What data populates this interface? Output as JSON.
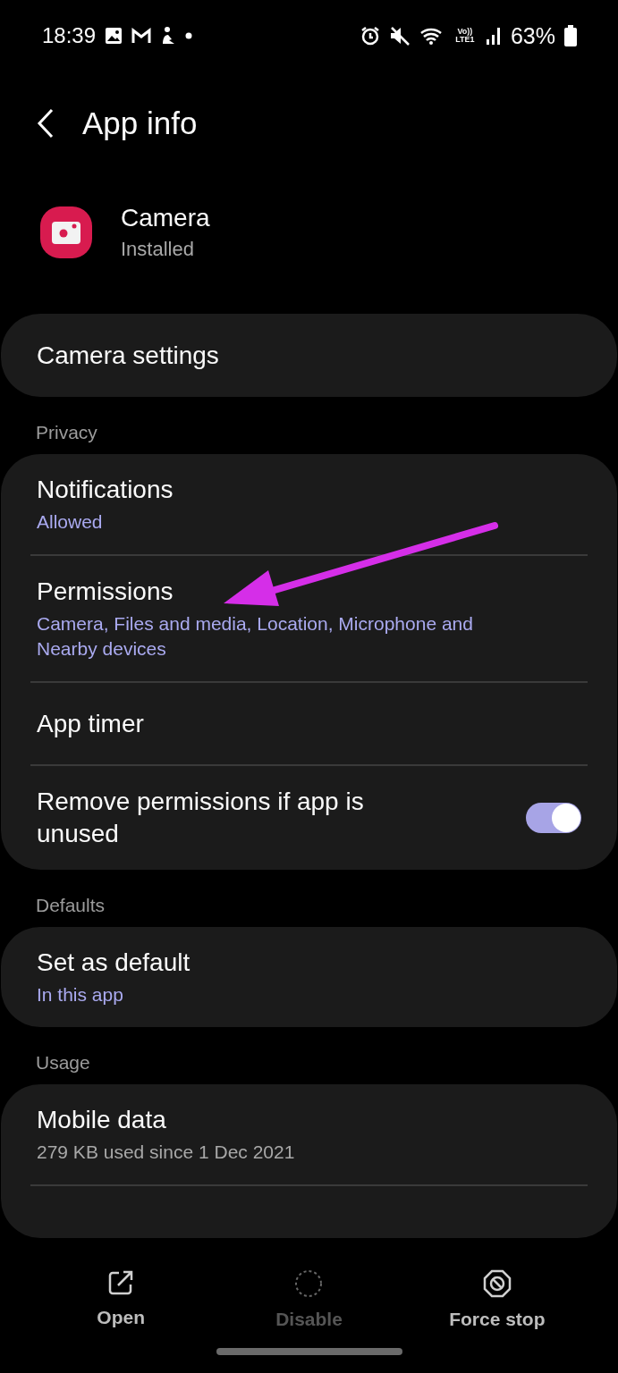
{
  "status_bar": {
    "time": "18:39",
    "network_label": "Vo)) LTE1",
    "battery": "63%"
  },
  "header": {
    "title": "App info"
  },
  "app": {
    "name": "Camera",
    "status": "Installed"
  },
  "sections": [
    {
      "items": [
        {
          "kind": "link",
          "title": "Camera settings"
        }
      ]
    },
    {
      "label": "Privacy",
      "items": [
        {
          "kind": "link",
          "title": "Notifications",
          "subtitle": "Allowed"
        },
        {
          "kind": "link",
          "title": "Permissions",
          "subtitle": "Camera, Files and media, Location, Microphone and Nearby devices"
        },
        {
          "kind": "link",
          "title": "App timer"
        },
        {
          "kind": "toggle",
          "title": "Remove permissions if app is unused",
          "on": true
        }
      ]
    },
    {
      "label": "Defaults",
      "items": [
        {
          "kind": "link",
          "title": "Set as default",
          "subtitle": "In this app"
        }
      ]
    },
    {
      "label": "Usage",
      "items": [
        {
          "kind": "link",
          "title": "Mobile data",
          "subtitle": "279 KB used since 1 Dec 2021",
          "muted_subtitle": true
        },
        {
          "kind": "blank"
        }
      ]
    }
  ],
  "bottom_actions": [
    {
      "kind": "open",
      "label": "Open",
      "disabled": false
    },
    {
      "kind": "disable",
      "label": "Disable",
      "disabled": true
    },
    {
      "kind": "stop",
      "label": "Force stop",
      "disabled": false
    }
  ]
}
